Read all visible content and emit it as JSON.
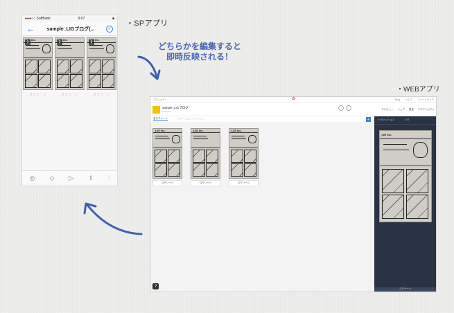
{
  "labels": {
    "sp_app": "・SPアプリ",
    "web_app": "・WEBアプリ",
    "caption_line1": "どちらかを編集すると",
    "caption_line2": "即時反映される！"
  },
  "phone": {
    "carrier": "●●●○○ SoftBank",
    "time": "9:07",
    "battery": "■",
    "title": "sample_LIGブログ(...",
    "screens": [
      {
        "num": "1",
        "label": "スクリーン"
      },
      {
        "num": "2",
        "label": "スクリーン"
      },
      {
        "num": "3",
        "label": "スクリーン"
      }
    ],
    "toolbar_icons": [
      "camera-icon",
      "tag-icon",
      "play-icon",
      "share-icon",
      "settings-icon"
    ]
  },
  "web": {
    "topbar_left": "プロジェクト",
    "topbar_links": [
      "Blog",
      "ヘルプ",
      "フィードバック"
    ],
    "project_name": "sample_LIGブログ",
    "project_sub": "3 screens",
    "tabs": [
      "全スクリーン",
      "ステータスアウトライン"
    ],
    "actions": [
      "プレビュー",
      "シェア",
      "設定",
      "アクティビティ"
    ],
    "thumbs": [
      {
        "label": "スクリーン"
      },
      {
        "label": "スクリーン"
      },
      {
        "label": "スクリーン"
      }
    ],
    "side_tabs": [
      "トランジション",
      "メモ"
    ],
    "side_bottom": "スクリーン",
    "sketch_header": "LIG inc.",
    "help": "?",
    "plus": "+"
  }
}
